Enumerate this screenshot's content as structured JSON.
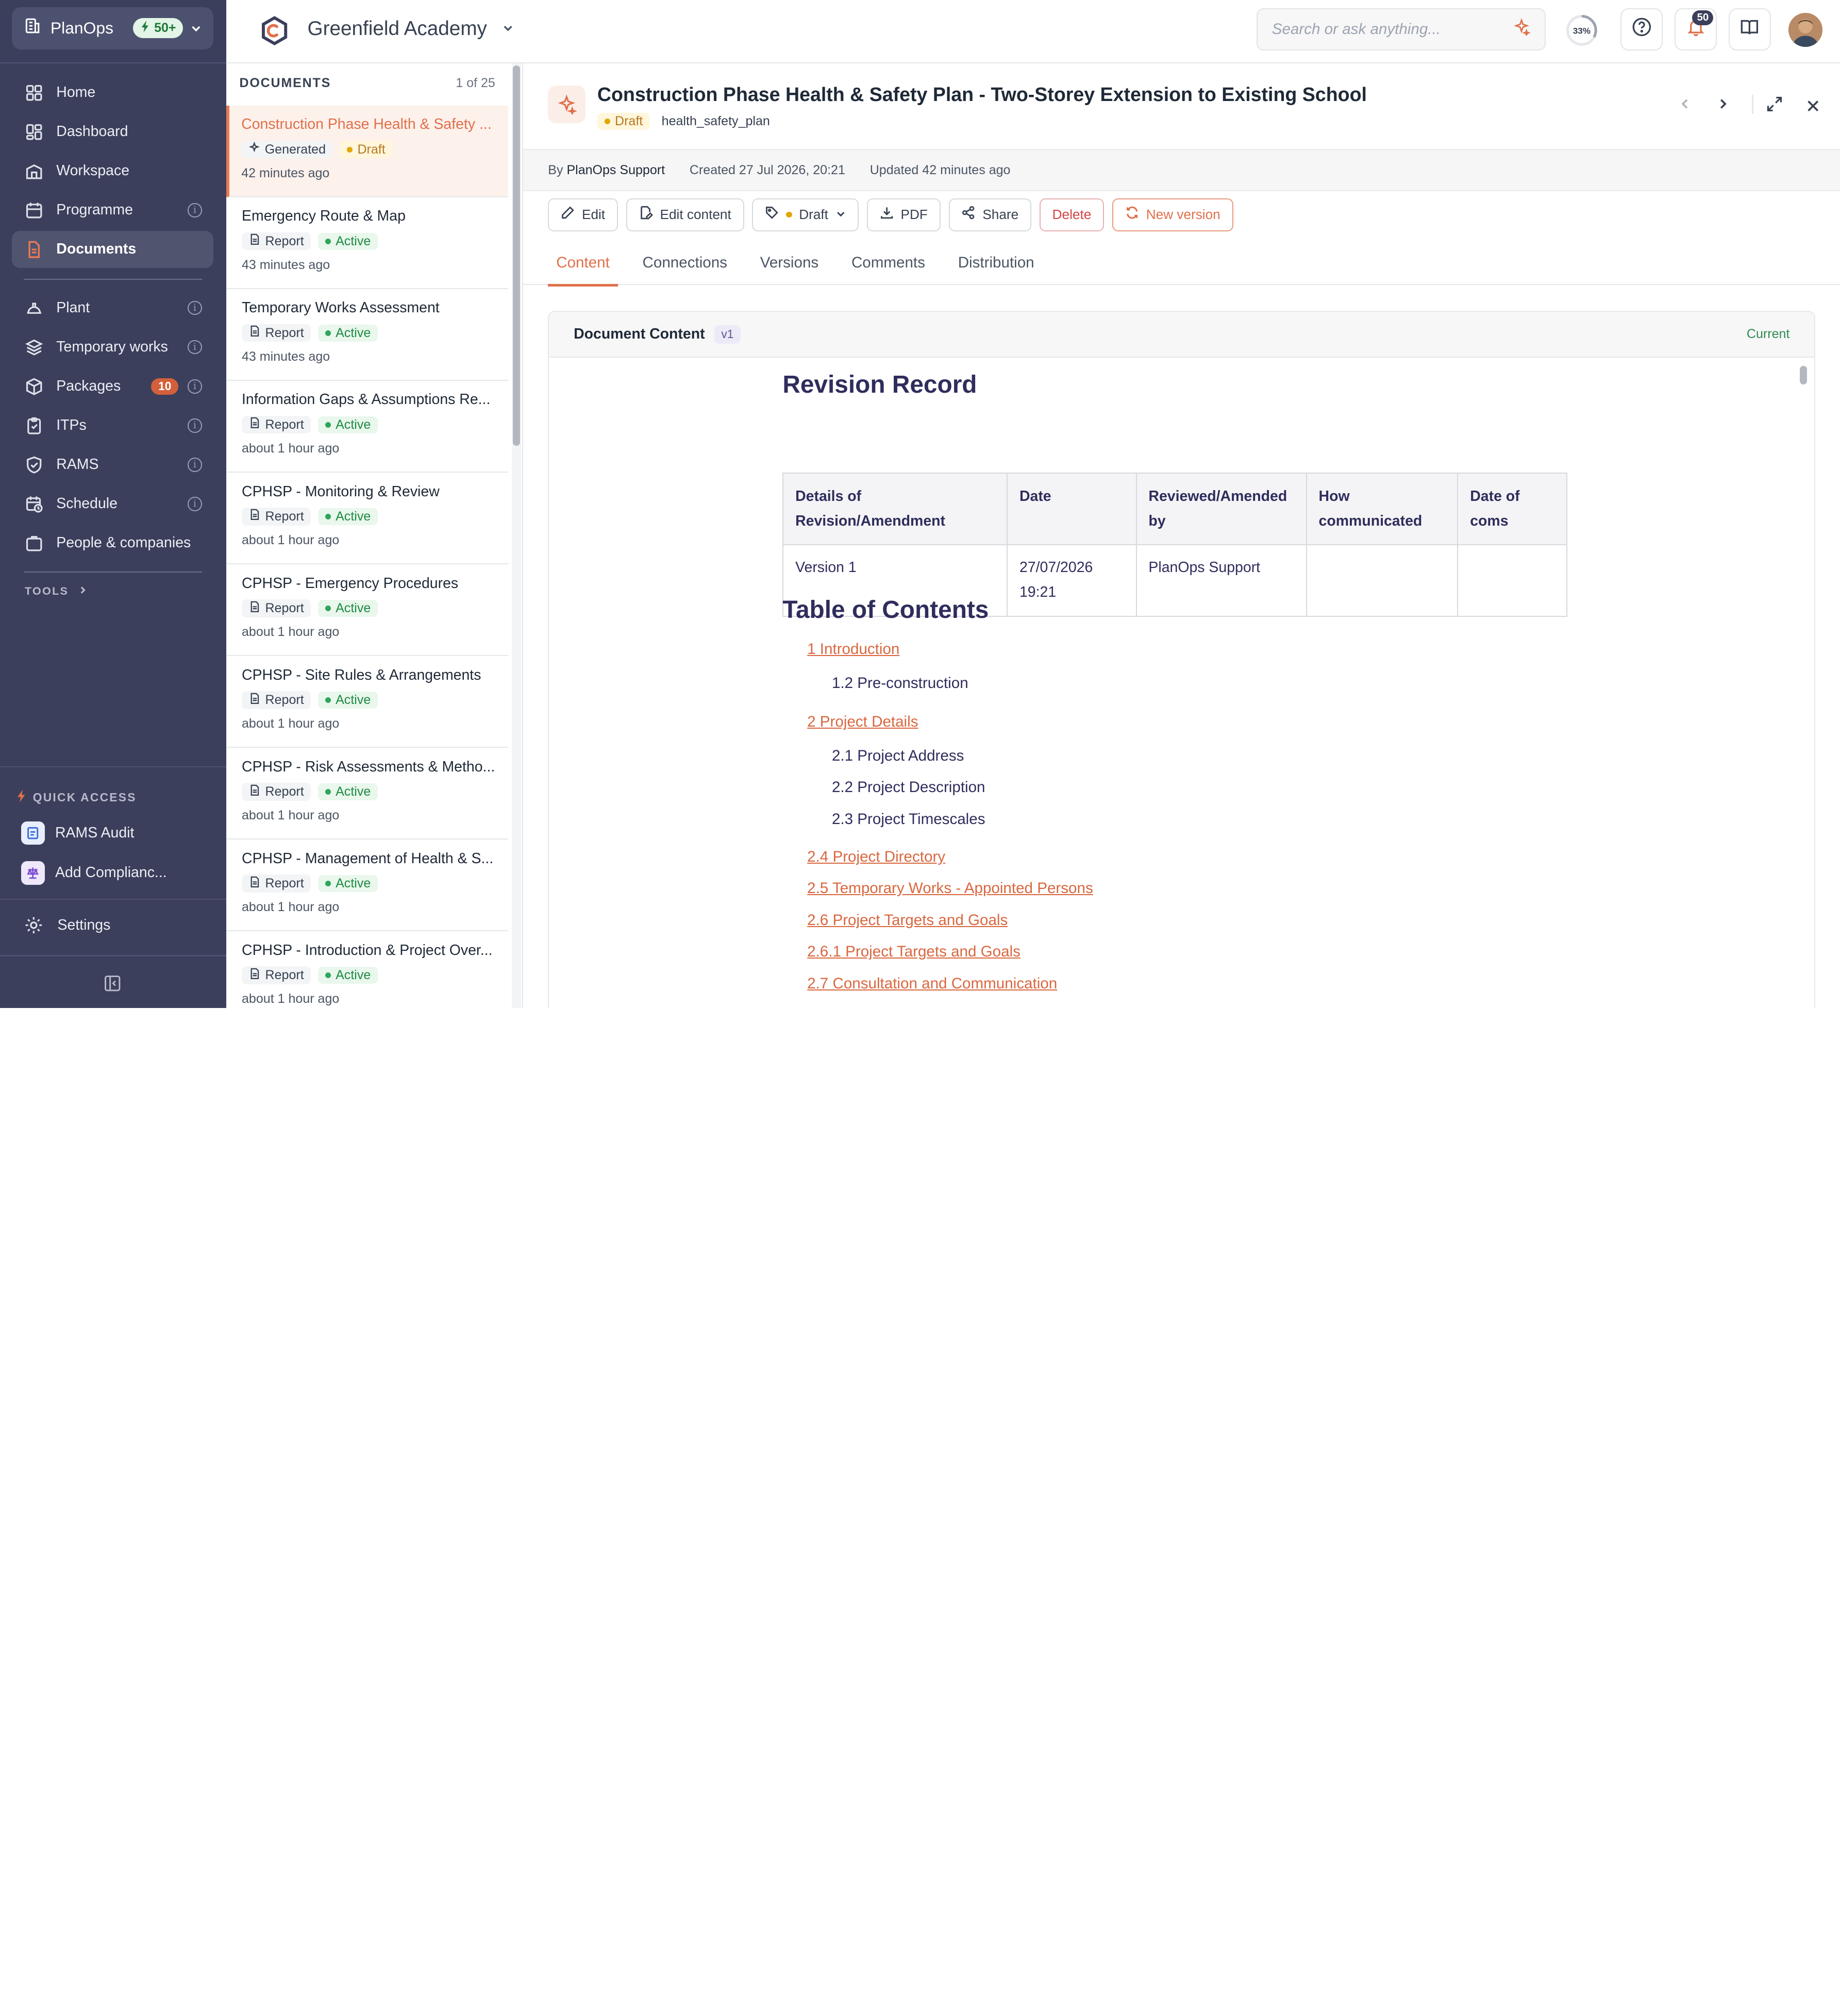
{
  "sidebar": {
    "org_name": "PlanOps",
    "credits_badge": "50+",
    "nav_primary": [
      {
        "label": "Home",
        "icon": "grid-icon"
      },
      {
        "label": "Dashboard",
        "icon": "dashboard-icon"
      },
      {
        "label": "Workspace",
        "icon": "building-icon"
      },
      {
        "label": "Programme",
        "icon": "calendar-icon"
      },
      {
        "label": "Documents",
        "icon": "document-icon"
      }
    ],
    "nav_secondary": [
      {
        "label": "Plant",
        "icon": "hard-hat-icon"
      },
      {
        "label": "Temporary works",
        "icon": "layers-icon"
      },
      {
        "label": "Packages",
        "icon": "package-icon",
        "count": "10"
      },
      {
        "label": "ITPs",
        "icon": "clipboard-icon"
      },
      {
        "label": "RAMS",
        "icon": "shield-icon"
      },
      {
        "label": "Schedule",
        "icon": "calendar-clock-icon"
      },
      {
        "label": "People & companies",
        "icon": "people-icon"
      }
    ],
    "tools_label": "TOOLS",
    "quick_access_label": "QUICK ACCESS",
    "quick_access": [
      {
        "label": "RAMS Audit"
      },
      {
        "label": "Add Complianc..."
      }
    ],
    "settings_label": "Settings"
  },
  "topbar": {
    "project_name": "Greenfield Academy",
    "search_placeholder": "Search or ask anything...",
    "progress": 0.33,
    "progress_label": "33%",
    "notifications_count": "50"
  },
  "doclist": {
    "title": "DOCUMENTS",
    "counter": "1 of 25",
    "items": [
      {
        "title": "Construction Phase Health & Safety ...",
        "type": "Generated",
        "status": "Draft",
        "ago": "42 minutes ago"
      },
      {
        "title": "Emergency Route & Map",
        "type": "Report",
        "status": "Active",
        "ago": "43 minutes ago"
      },
      {
        "title": "Temporary Works Assessment",
        "type": "Report",
        "status": "Active",
        "ago": "43 minutes ago"
      },
      {
        "title": "Information Gaps & Assumptions Re...",
        "type": "Report",
        "status": "Active",
        "ago": "about 1 hour ago"
      },
      {
        "title": "CPHSP - Monitoring & Review",
        "type": "Report",
        "status": "Active",
        "ago": "about 1 hour ago"
      },
      {
        "title": "CPHSP - Emergency Procedures",
        "type": "Report",
        "status": "Active",
        "ago": "about 1 hour ago"
      },
      {
        "title": "CPHSP - Site Rules & Arrangements",
        "type": "Report",
        "status": "Active",
        "ago": "about 1 hour ago"
      },
      {
        "title": "CPHSP - Risk Assessments & Metho...",
        "type": "Report",
        "status": "Active",
        "ago": "about 1 hour ago"
      },
      {
        "title": "CPHSP - Management of Health & S...",
        "type": "Report",
        "status": "Active",
        "ago": "about 1 hour ago"
      },
      {
        "title": "CPHSP - Introduction & Project Over...",
        "type": "Report",
        "status": "Active",
        "ago": "about 1 hour ago"
      }
    ]
  },
  "detail": {
    "title": "Construction Phase Health & Safety Plan - Two-Storey Extension to Existing School",
    "status": "Draft",
    "type_code": "health_safety_plan",
    "by_prefix": "By",
    "author": "PlanOps Support",
    "created": "Created 27 Jul 2026, 20:21",
    "updated": "Updated 42 minutes ago",
    "actions": {
      "edit": "Edit",
      "edit_content": "Edit content",
      "status": "Draft",
      "pdf": "PDF",
      "share": "Share",
      "delete": "Delete",
      "new_version": "New version"
    },
    "tabs": [
      "Content",
      "Connections",
      "Versions",
      "Comments",
      "Distribution"
    ],
    "content_card": {
      "heading": "Document Content",
      "version": "v1",
      "current": "Current"
    },
    "revision": {
      "heading": "Revision Record",
      "headers": [
        "Details of Revision/Amendment",
        "Date",
        "Reviewed/Amended by",
        "How communicated",
        "Date of coms"
      ],
      "rows": [
        [
          "Version 1",
          "27/07/2026 19:21",
          "PlanOps Support",
          "",
          ""
        ]
      ]
    },
    "toc": {
      "heading": "Table of Contents",
      "items": [
        {
          "text": "1 Introduction",
          "link": true
        },
        {
          "text": "1.2 Pre-construction",
          "link": false
        },
        {
          "text": "2 Project Details",
          "link": true
        },
        {
          "text": "2.1 Project Address",
          "link": false
        },
        {
          "text": "2.2 Project Description",
          "link": false
        },
        {
          "text": "2.3 Project Timescales",
          "link": false
        },
        {
          "text": "2.4 Project Directory",
          "link": true
        },
        {
          "text": "2.5 Temporary Works - Appointed Persons",
          "link": true
        },
        {
          "text": "2.6 Project Targets and Goals",
          "link": true
        },
        {
          "text": "2.6.1 Project Targets and Goals",
          "link": true
        },
        {
          "text": "2.7 Consultation and Communication",
          "link": true
        }
      ]
    }
  },
  "colors": {
    "sidebar_bg": "#3c3f5b",
    "accent": "#e0704a",
    "active_green": "#1f8a44",
    "draft_amber": "#b7791f"
  }
}
